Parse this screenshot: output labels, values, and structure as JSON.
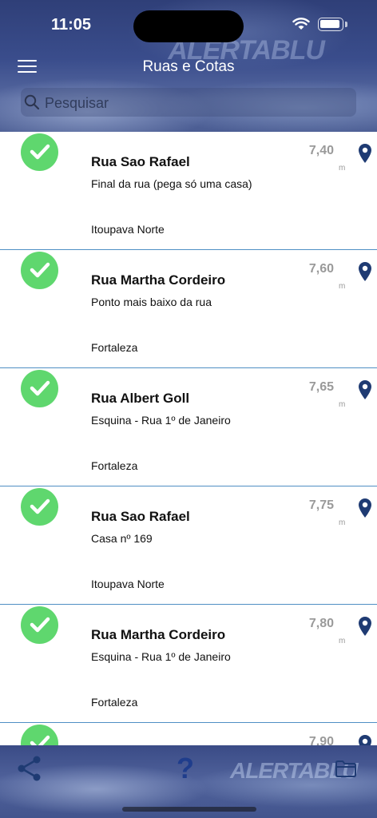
{
  "status_bar": {
    "time": "11:05"
  },
  "header": {
    "title": "Ruas e Cotas",
    "watermark": "ALERTABLU",
    "search_placeholder": "Pesquisar"
  },
  "items": [
    {
      "street": "Rua Sao Rafael",
      "description": "Final da rua (pega só uma casa)",
      "district": "Itoupava Norte",
      "value": "7,40",
      "unit": "m"
    },
    {
      "street": "Rua Martha Cordeiro",
      "description": "Ponto mais baixo da rua",
      "district": "Fortaleza",
      "value": "7,60",
      "unit": "m"
    },
    {
      "street": "Rua Albert Goll",
      "description": "Esquina - Rua 1º de Janeiro",
      "district": "Fortaleza",
      "value": "7,65",
      "unit": "m"
    },
    {
      "street": "Rua Sao Rafael",
      "description": "Casa nº 169",
      "district": "Itoupava Norte",
      "value": "7,75",
      "unit": "m"
    },
    {
      "street": "Rua Martha Cordeiro",
      "description": "Esquina - Rua 1º de Janeiro",
      "district": "Fortaleza",
      "value": "7,80",
      "unit": "m"
    },
    {
      "street": "",
      "description": "",
      "district": "",
      "value": "7,90",
      "unit": ""
    }
  ],
  "bottom_bar": {
    "help_label": "?",
    "watermark": "ALERTABLU"
  },
  "colors": {
    "check": "#5fd76e",
    "pin": "#1f3b73",
    "divider": "#4f8fc4",
    "value": "#9a9a9a"
  }
}
